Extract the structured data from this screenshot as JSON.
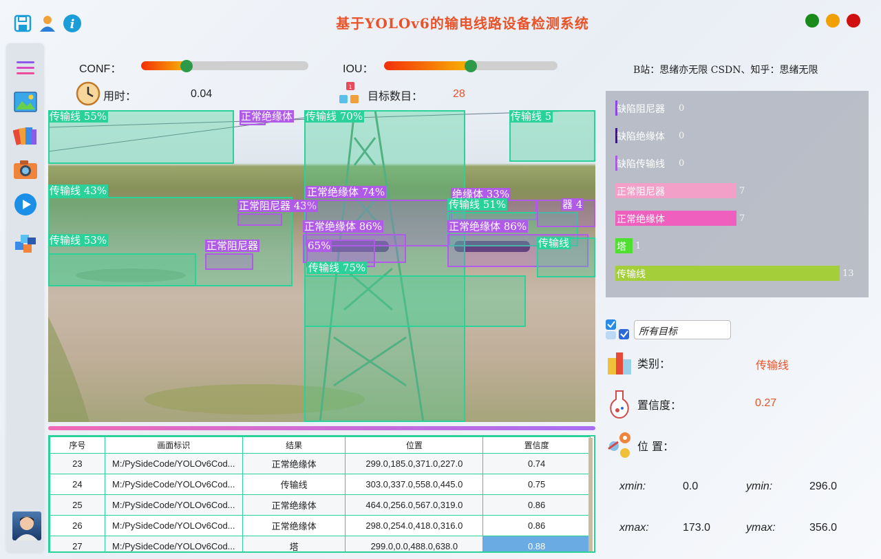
{
  "window": {
    "title": "基于YOLOv6的输电线路设备检测系统",
    "buttons": {
      "green": "#1a8a1a",
      "yellow": "#f0a000",
      "red": "#d01010"
    }
  },
  "toolbar": {
    "icons": [
      "save-icon",
      "user-icon",
      "info-icon"
    ]
  },
  "sidebar": {
    "icons": [
      "menu-icon",
      "image-icon",
      "folder-icon",
      "camera-icon",
      "play-icon",
      "cube-icon",
      "avatar"
    ]
  },
  "controls": {
    "conf_label": "CONF：",
    "conf_value": 0.27,
    "iou_label": "IOU：",
    "iou_value": 0.5,
    "time_label": "用时：",
    "time_value": "0.04",
    "count_label": "目标数目：",
    "count_value": "28"
  },
  "credits": "B站：思绪亦无限  CSDN、知乎：思绪无限",
  "detections": [
    {
      "label": "传输线 55%",
      "color": "#2ad29a"
    },
    {
      "label": "传输线 70%",
      "color": "#2ad29a"
    },
    {
      "label": "正常绝缘体",
      "color": "#b05ae8"
    },
    {
      "label": "传输线 5",
      "color": "#2ad29a"
    },
    {
      "label": "传输线 43%",
      "color": "#2ad29a"
    },
    {
      "label": "正常阻尼器 43%",
      "color": "#b05ae8"
    },
    {
      "label": "正常绝缘体 74%",
      "color": "#b05ae8"
    },
    {
      "label": "绝缘体 33%",
      "color": "#b05ae8"
    },
    {
      "label": "传输线 51%",
      "color": "#2ad29a"
    },
    {
      "label": "器 4",
      "color": "#b05ae8"
    },
    {
      "label": "正常绝缘体 86%",
      "color": "#b05ae8"
    },
    {
      "label": "正常绝缘体 86%",
      "color": "#b05ae8"
    },
    {
      "label": "传输线 53%",
      "color": "#2ad29a"
    },
    {
      "label": "正常阻尼器",
      "color": "#b05ae8"
    },
    {
      "label": "65%",
      "color": "#b05ae8"
    },
    {
      "label": "传输线",
      "color": "#2ad29a"
    },
    {
      "label": "传输线 75%",
      "color": "#2ad29a"
    }
  ],
  "table": {
    "headers": [
      "序号",
      "画面标识",
      "结果",
      "位置",
      "置信度"
    ],
    "rows": [
      [
        "23",
        "M:/PySideCode/YOLOv6Cod...",
        "正常绝缘体",
        "299.0,185.0,371.0,227.0",
        "0.74"
      ],
      [
        "24",
        "M:/PySideCode/YOLOv6Cod...",
        "传输线",
        "303.0,337.0,558.0,445.0",
        "0.75"
      ],
      [
        "25",
        "M:/PySideCode/YOLOv6Cod...",
        "正常绝缘体",
        "464.0,256.0,567.0,319.0",
        "0.86"
      ],
      [
        "26",
        "M:/PySideCode/YOLOv6Cod...",
        "正常绝缘体",
        "298.0,254.0,418.0,316.0",
        "0.86"
      ],
      [
        "27",
        "M:/PySideCode/YOLOv6Cod...",
        "塔",
        "299.0,0.0,488.0,638.0",
        "0.88"
      ]
    ],
    "selected_row": 4
  },
  "stats": [
    {
      "name": "缺陷阻尼器",
      "count": "0",
      "value": 0,
      "color": "#8a44e8"
    },
    {
      "name": "缺陷绝缘体",
      "count": "0",
      "value": 0,
      "color": "#3a1a7a"
    },
    {
      "name": "缺陷传输线",
      "count": "0",
      "value": 0,
      "color": "#a85ae0"
    },
    {
      "name": "正常阻尼器",
      "count": "7",
      "value": 7,
      "color": "#f3a0c8"
    },
    {
      "name": "正常绝缘体",
      "count": "7",
      "value": 7,
      "color": "#ee5fbe"
    },
    {
      "name": "塔",
      "count": "1",
      "value": 1,
      "color": "#4ee030"
    },
    {
      "name": "传输线",
      "count": "13",
      "value": 13,
      "color": "#a5cf3a"
    }
  ],
  "filter": {
    "selected": "所有目标"
  },
  "detail": {
    "class_label": "类别：",
    "class_value": "传输线",
    "conf_label": "置信度：",
    "conf_value": "0.27",
    "pos_label": "位 置：",
    "xmin_label": "xmin:",
    "xmin": "0.0",
    "ymin_label": "ymin:",
    "ymin": "296.0",
    "xmax_label": "xmax:",
    "xmax": "173.0",
    "ymax_label": "ymax:",
    "ymax": "356.0"
  }
}
